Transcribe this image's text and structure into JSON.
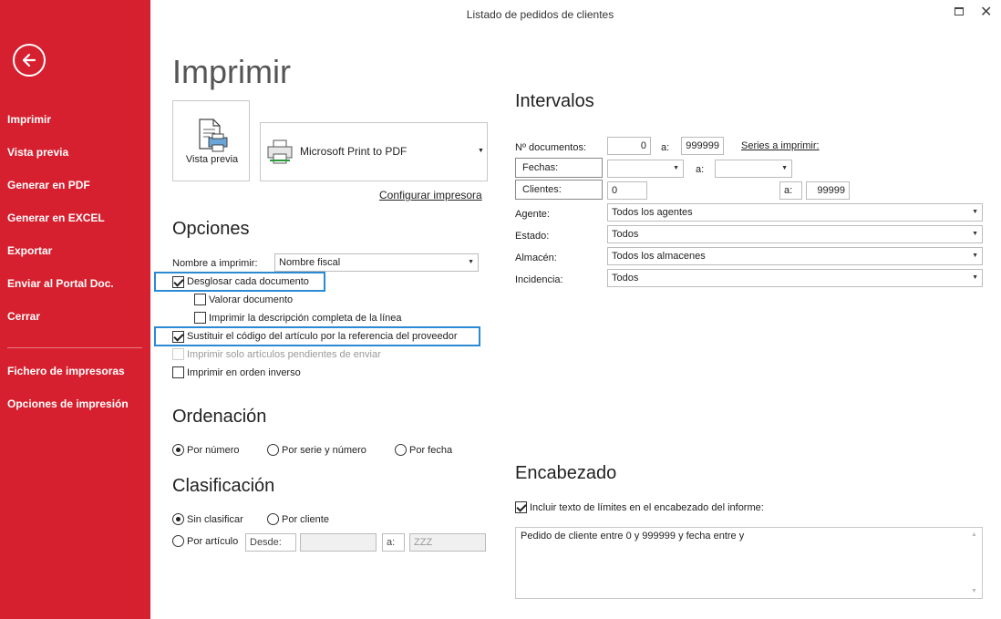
{
  "window": {
    "title": "Listado de pedidos de clientes"
  },
  "sidebar": {
    "items": [
      {
        "label": "Imprimir"
      },
      {
        "label": "Vista previa"
      },
      {
        "label": "Generar en PDF"
      },
      {
        "label": "Generar en EXCEL"
      },
      {
        "label": "Exportar"
      },
      {
        "label": "Enviar al Portal Doc."
      },
      {
        "label": "Cerrar"
      },
      {
        "label": "Fichero de impresoras"
      },
      {
        "label": "Opciones de impresión"
      }
    ],
    "colors": {
      "background": "#d6202f"
    }
  },
  "print": {
    "title": "Imprimir",
    "preview_label": "Vista previa",
    "printer_name": "Microsoft Print to PDF",
    "configure_link": "Configurar impresora"
  },
  "options": {
    "title": "Opciones",
    "name_label": "Nombre a imprimir:",
    "name_value": "Nombre fiscal",
    "checks": [
      {
        "label": "Desglosar cada documento",
        "checked": true
      },
      {
        "label": "Valorar documento",
        "checked": false
      },
      {
        "label": "Imprimir la descripción completa de la línea",
        "checked": false
      },
      {
        "label": "Sustituir el código del artículo por la referencia del proveedor",
        "checked": true
      },
      {
        "label": "Imprimir solo artículos pendientes de enviar",
        "checked": false,
        "disabled": true
      },
      {
        "label": "Imprimir en orden inverso",
        "checked": false
      }
    ]
  },
  "ordering": {
    "title": "Ordenación",
    "options": [
      {
        "label": "Por número",
        "selected": true
      },
      {
        "label": "Por serie y número",
        "selected": false
      },
      {
        "label": "Por fecha",
        "selected": false
      }
    ]
  },
  "classification": {
    "title": "Clasificación",
    "options": [
      {
        "label": "Sin clasificar",
        "selected": true
      },
      {
        "label": "Por cliente",
        "selected": false
      },
      {
        "label": "Por artículo",
        "selected": false
      }
    ],
    "from_label": "Desde:",
    "from_value": "",
    "to_label": "a:",
    "to_value": "ZZZ"
  },
  "intervals": {
    "title": "Intervalos",
    "documents_label": "Nº documentos:",
    "documents_from": "0",
    "to_label": "a:",
    "documents_to": "999999",
    "series_link": "Series a imprimir:",
    "dates_label": "Fechas:",
    "dates_from": "",
    "dates_to": "",
    "clients_label": "Clientes:",
    "clients_from": "0",
    "clients_to": "99999",
    "agent_label": "Agente:",
    "agent_value": "Todos los agentes",
    "state_label": "Estado:",
    "state_value": "Todos",
    "warehouse_label": "Almacén:",
    "warehouse_value": "Todos los almacenes",
    "incident_label": "Incidencia:",
    "incident_value": "Todos"
  },
  "header": {
    "title": "Encabezado",
    "include_label": "Incluir texto de límites en el encabezado del informe:",
    "include_checked": true,
    "text": "Pedido de cliente entre 0 y 999999 y fecha entre  y"
  },
  "colors": {
    "highlight": "#2a8ad4"
  }
}
